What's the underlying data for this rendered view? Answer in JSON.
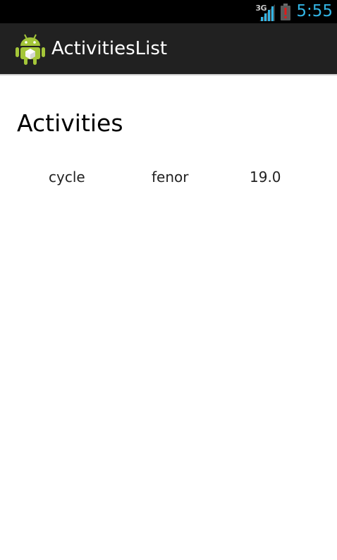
{
  "status_bar": {
    "network_type": "3G",
    "signal_icon": "signal-bars-icon",
    "battery_icon": "battery-alert-icon",
    "time": "5:55",
    "time_color": "#33b5e5"
  },
  "action_bar": {
    "app_icon": "android-robot-icon",
    "title": "ActivitiesList",
    "background": "#212121"
  },
  "main": {
    "heading": "Activities",
    "activities": [
      {
        "name": "cycle",
        "user": "fenor",
        "value": "19.0"
      }
    ]
  }
}
